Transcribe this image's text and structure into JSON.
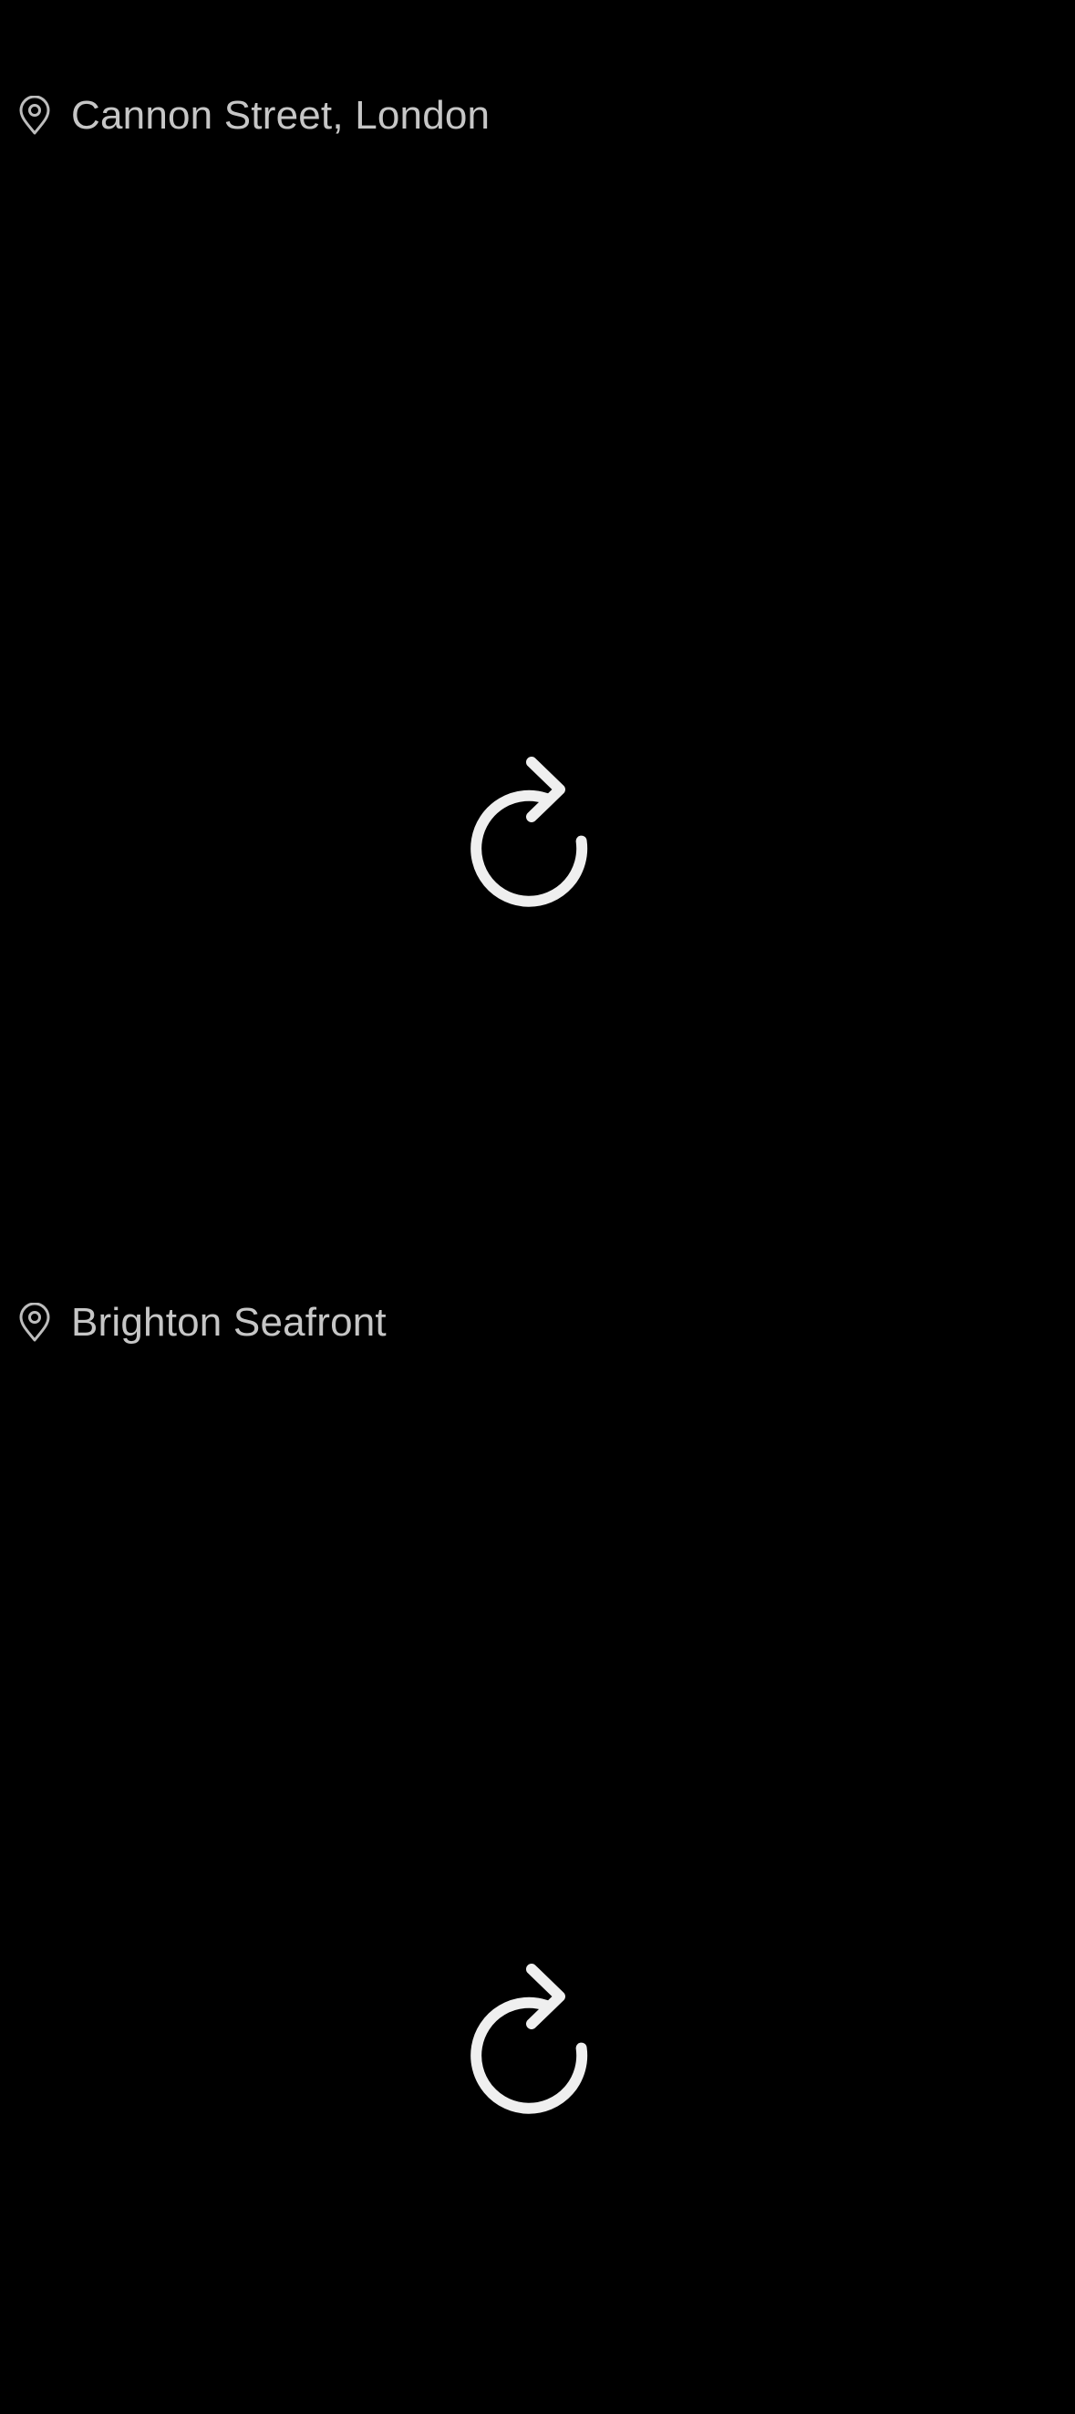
{
  "feed": {
    "posts": [
      {
        "location": "Cannon Street, London",
        "location_icon": "map-pin-icon",
        "media_state_icon": "reload-icon"
      },
      {
        "location": "Brighton Seafront",
        "location_icon": "map-pin-icon",
        "media_state_icon": "reload-icon"
      }
    ]
  },
  "colors": {
    "background": "#000000",
    "location_text": "#c6c6c6",
    "pin_icon": "#bdbdbd",
    "reload_icon": "#efefef"
  }
}
